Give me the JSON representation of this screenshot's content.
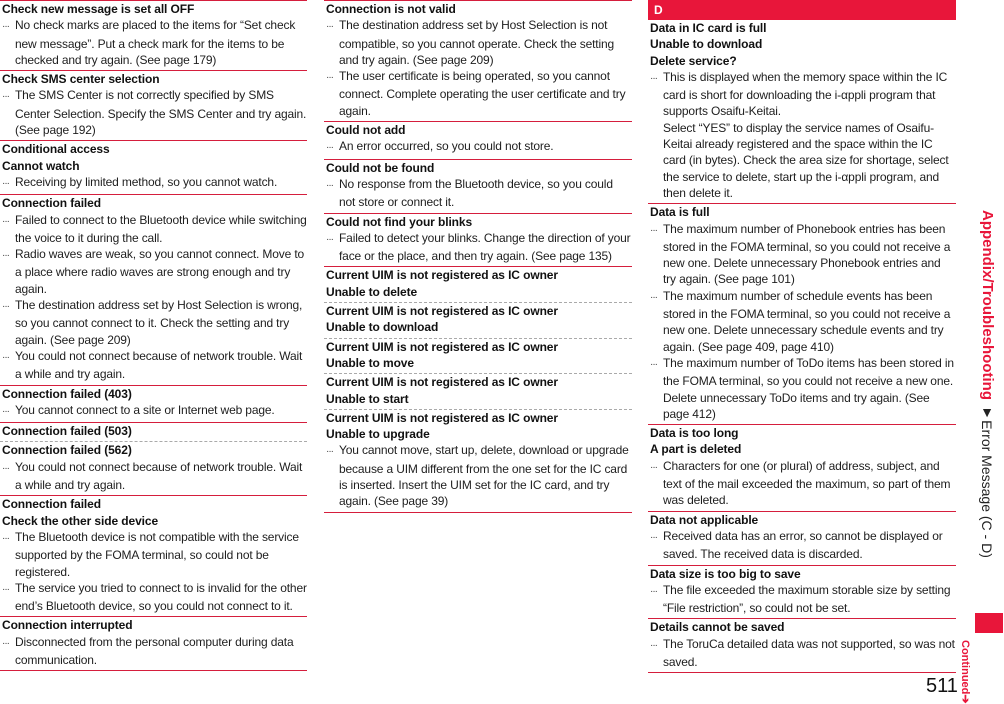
{
  "sidebar": {
    "section": "Appendix/Troubleshooting",
    "subsection": "▼Error Message (C - D)",
    "continued": "Continued➔"
  },
  "page_number": "511",
  "column1": [
    {
      "titles": [
        "Check new message is set all OFF"
      ],
      "desc": [
        "No check marks are placed to the items for “Set check new message”. Put a check mark for the items to be checked and try again. (See page 179)"
      ]
    },
    {
      "titles": [
        "Check SMS center selection"
      ],
      "desc": [
        "The SMS Center is not correctly specified by SMS Center Selection. Specify the SMS Center and try again. (See page 192)"
      ]
    },
    {
      "titles": [
        "Conditional access",
        "Cannot watch"
      ],
      "desc": [
        "Receiving by limited method, so you cannot watch."
      ]
    },
    {
      "titles": [
        "Connection failed"
      ],
      "desc": [
        "Failed to connect to the Bluetooth device while switching the voice to it during the call.",
        "Radio waves are weak, so you cannot connect. Move to a place where radio waves are strong enough and try again.",
        "The destination address set by Host Selection is wrong, so you cannot connect to it. Check the setting and try again. (See page 209)",
        "You could not connect because of network trouble. Wait a while and try again."
      ]
    },
    {
      "titles": [
        "Connection failed (403)"
      ],
      "desc": [
        "You cannot connect to a site or Internet web page."
      ]
    },
    {
      "titles": [
        "Connection failed (503)"
      ],
      "desc": [],
      "dashed": true
    },
    {
      "titles": [
        "Connection failed (562)"
      ],
      "desc": [
        "You could not connect because of network trouble. Wait a while and try again."
      ]
    },
    {
      "titles": [
        "Connection failed",
        "Check the other side device"
      ],
      "desc": [
        "The Bluetooth device is not compatible with the service supported by the FOMA terminal, so could not be registered.",
        "The service you tried to connect to is invalid for the other end’s Bluetooth device, so you could not connect to it."
      ]
    },
    {
      "titles": [
        "Connection interrupted"
      ],
      "desc": [
        "Disconnected from the personal computer during data communication."
      ]
    }
  ],
  "column2": [
    {
      "titles": [
        "Connection is not valid"
      ],
      "desc": [
        "The destination address set by Host Selection is not compatible, so you cannot operate. Check the setting and try again. (See page 209)",
        "The user certificate is being operated, so you cannot connect. Complete operating the user certificate and try again."
      ]
    },
    {
      "titles": [
        "Could not add"
      ],
      "desc": [
        "An error occurred, so you could not store."
      ]
    },
    {
      "titles": [
        "Could not be found"
      ],
      "desc": [
        "No response from the Bluetooth device, so you could not store or connect it."
      ]
    },
    {
      "titles": [
        "Could not find your blinks"
      ],
      "desc": [
        "Failed to detect your blinks. Change the direction of your face or the place, and then try again. (See page 135)"
      ]
    },
    {
      "titles": [
        "Current UIM is not registered as IC owner",
        "Unable to delete"
      ],
      "desc": [],
      "dashed": true
    },
    {
      "titles": [
        "Current UIM is not registered as IC owner",
        "Unable to download"
      ],
      "desc": [],
      "dashed": true
    },
    {
      "titles": [
        "Current UIM is not registered as IC owner",
        "Unable to move"
      ],
      "desc": [],
      "dashed": true
    },
    {
      "titles": [
        "Current UIM is not registered as IC owner",
        "Unable to start"
      ],
      "desc": [],
      "dashed": true
    },
    {
      "titles": [
        "Current UIM is not registered as IC owner",
        "Unable to upgrade"
      ],
      "desc": [
        "You cannot move, start up, delete, download or upgrade because a UIM different from the one set for the IC card is inserted. Insert the UIM set for the IC card, and try again. (See page 39)"
      ]
    }
  ],
  "column3_header": "D",
  "column3": [
    {
      "titles": [
        "Data in IC card is full",
        "Unable to download",
        "Delete service?"
      ],
      "desc": [
        "This is displayed when the memory space within the IC card is short for downloading the i-αppli program that supports Osaifu-Keitai."
      ],
      "extra": "Select “YES” to display the service names of Osaifu-Keitai already registered and the space within the IC card (in bytes). Check the area size for shortage, select the service to delete, start up the i-αppli program, and then delete it."
    },
    {
      "titles": [
        "Data is full"
      ],
      "desc": [
        "The maximum number of Phonebook entries has been stored in the FOMA terminal, so you could not receive a new one. Delete unnecessary Phonebook entries and try again. (See page 101)",
        "The maximum number of schedule events has been stored in the FOMA terminal, so you could not receive a new one. Delete unnecessary schedule events and try again. (See page 409, page 410)",
        "The maximum number of ToDo items has been stored in the FOMA terminal, so you could not receive a new one. Delete unnecessary ToDo items and try again. (See page 412)"
      ]
    },
    {
      "titles": [
        "Data is too long",
        "A part is deleted"
      ],
      "desc": [
        "Characters for one (or plural) of address, subject, and text of the mail exceeded the maximum, so part of them was deleted."
      ]
    },
    {
      "titles": [
        "Data not applicable"
      ],
      "desc": [
        "Received data has an error, so cannot be displayed or saved. The received data is discarded."
      ]
    },
    {
      "titles": [
        "Data size is too big to save"
      ],
      "desc": [
        "The file exceeded the maximum storable size by setting “File restriction”, so could not be set."
      ]
    },
    {
      "titles": [
        "Details cannot be saved"
      ],
      "desc": [
        "The ToruCa detailed data was not supported, so was not saved."
      ]
    }
  ]
}
